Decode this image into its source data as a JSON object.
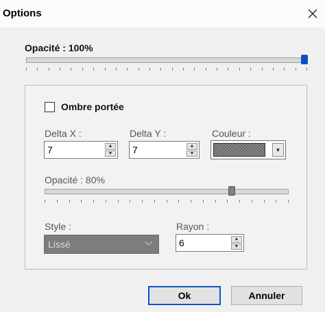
{
  "dialog": {
    "title": "Options",
    "close_icon": "close-icon"
  },
  "main_opacity": {
    "label": "Opacité : 100%",
    "value": 1.0
  },
  "shadow_group": {
    "checkbox_label": "Ombre portée",
    "checked": false,
    "delta_x": {
      "label": "Delta X :",
      "value": "7"
    },
    "delta_y": {
      "label": "Delta Y :",
      "value": "7"
    },
    "color": {
      "label": "Couleur :",
      "value": "#6e6e6e"
    },
    "opacity": {
      "label": "Opacité : 80%",
      "value": 0.8
    },
    "style": {
      "label": "Style :",
      "value": "Lissé"
    },
    "radius": {
      "label": "Rayon :",
      "value": "6"
    }
  },
  "buttons": {
    "ok": "Ok",
    "cancel": "Annuler"
  },
  "colors": {
    "accent": "#0b55c8",
    "dialog_bg": "#f0f0f0"
  }
}
